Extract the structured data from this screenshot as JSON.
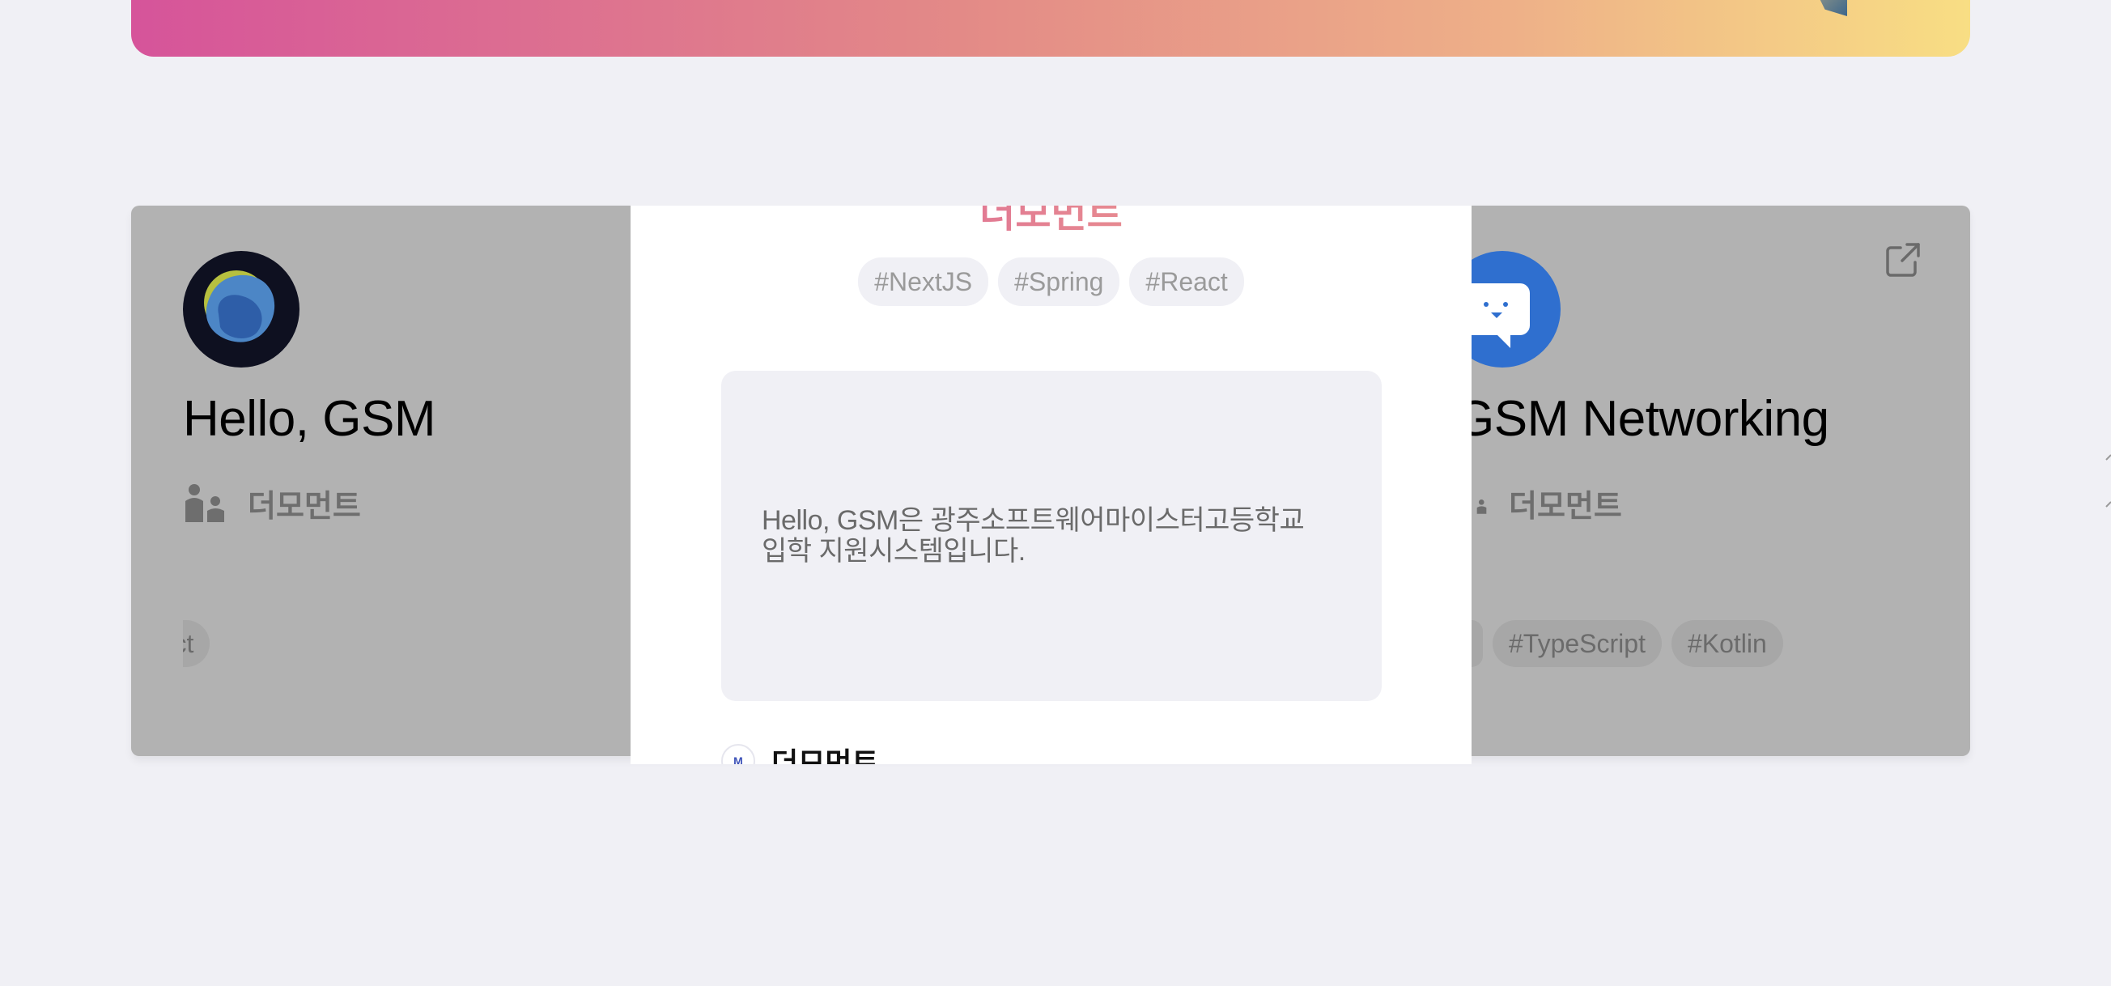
{
  "projects": {
    "left": {
      "title": "Hello, GSM",
      "team": "더모먼트",
      "tag_partial": "#React"
    },
    "right": {
      "title": "GSM Networking",
      "team": "더모먼트",
      "tags": [
        "#TypeScript",
        "#Kotlin"
      ]
    }
  },
  "modal": {
    "title": "더모먼트",
    "tags": [
      "#NextJS",
      "#Spring",
      "#React"
    ],
    "description_line1": "Hello, GSM은 광주소프트웨어마이스터고등학교",
    "description_line2": "입학 지원시스템입니다.",
    "team_logo_letter": "M",
    "team_name": "더모먼트"
  },
  "colors": {
    "page_bg": "#f0f0f5",
    "overlay": "#b2b2b2",
    "banner_start": "#d6549a",
    "banner_end": "#f8de84",
    "accent_blue": "#2f6fcf"
  },
  "icons": {
    "team": "people-icon",
    "open": "external-link-icon"
  }
}
